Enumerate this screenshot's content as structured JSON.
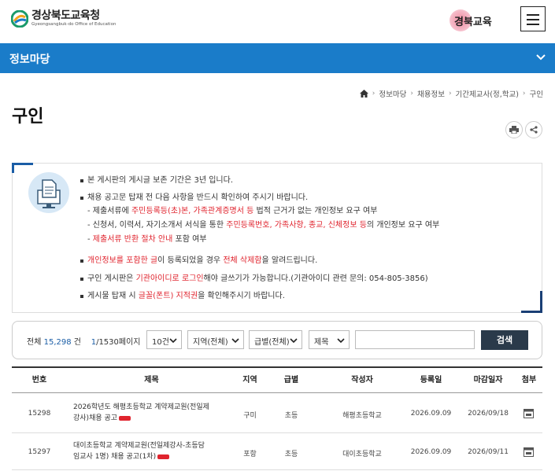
{
  "header": {
    "logo_title": "경상북도교육청",
    "logo_sub": "Gyeongsangbuk-do Office of Education",
    "brand_text": "경북교육",
    "brand_badge": "새로운"
  },
  "section": {
    "title": "정보마당"
  },
  "breadcrumb": [
    "정보마당",
    "채용정보",
    "기간제교사(정,학교)",
    "구인"
  ],
  "page_title": "구인",
  "notice": {
    "line1": "본 게시판의 게시글 보존 기간은 3년 입니다.",
    "line2": "채용 공고문 탑재 전 다음 사항을 반드시 확인하여 주시기 바랍니다.",
    "sub1": {
      "a": "- 제출서류에 ",
      "b": "주민등록등(초)본, 가족관계증명서 등",
      "c": " 법적 근거가 없는 개인정보 요구 여부"
    },
    "sub2": {
      "a": "- 신청서, 이력서, 자기소개서 서식을 통한 ",
      "b": "주민등록번호, 가족사항, 종교, 신체정보 등",
      "c": "의 개인정보 요구 여부"
    },
    "sub3": {
      "a": "- ",
      "b": "제출서류 반환 절차 안내",
      "c": " 포함 여부"
    },
    "line3": {
      "a": "개인정보를 포함한 글",
      "b": "이 등록되었을 경우 ",
      "c": "전체 삭제함",
      "d": "을 알려드립니다."
    },
    "line4": {
      "a": "구인 게시판은 ",
      "b": "기관아이디로 로그인",
      "c": "해야 글쓰기가 가능합니다.(기관아이디 관련 문의: 054-805-3856)"
    },
    "line5": {
      "a": "게시물 탑재 시 ",
      "b": "글꼴(폰트) 지적권",
      "c": "을 확인해주시기 바랍니다."
    }
  },
  "search": {
    "total_label": "전체",
    "total": "15,298",
    "total_unit": "건",
    "page_current": "1",
    "page_total": "/1530페이지",
    "per_page": "10건",
    "region": "지역(전체)",
    "level": "급별(전체)",
    "field": "제목",
    "query": "",
    "button": "검색"
  },
  "table": {
    "headers": [
      "번호",
      "제목",
      "지역",
      "급별",
      "작성자",
      "등록일",
      "마감일자",
      "첨부"
    ],
    "rows": [
      {
        "no": "15298",
        "title1": "2026학년도 해평초등학교 계약제교원(전일제",
        "title2": "강사)채용 공고",
        "region": "구미",
        "level": "초등",
        "author": "해평초등학교",
        "date": "2026.09.09",
        "deadline": "2026/09/18"
      },
      {
        "no": "15297",
        "title1": "대이초등학교 계약제교원(전일제강사-초등담",
        "title2": "임교사 1명) 채용 공고(1차)",
        "region": "포항",
        "level": "초등",
        "author": "대이초등학교",
        "date": "2026.09.09",
        "deadline": "2026/09/11"
      }
    ]
  },
  "colors": {
    "primary": "#1a7cc9",
    "accent_red": "#e0242e",
    "button_dark": "#2a3a4a"
  },
  "icons": [
    "logo-icon",
    "menu-icon",
    "chevron-down-icon",
    "home-icon",
    "print-icon",
    "share-icon",
    "document-monitor-icon",
    "dropdown-arrow-icon",
    "new-badge-icon",
    "attachment-icon"
  ]
}
